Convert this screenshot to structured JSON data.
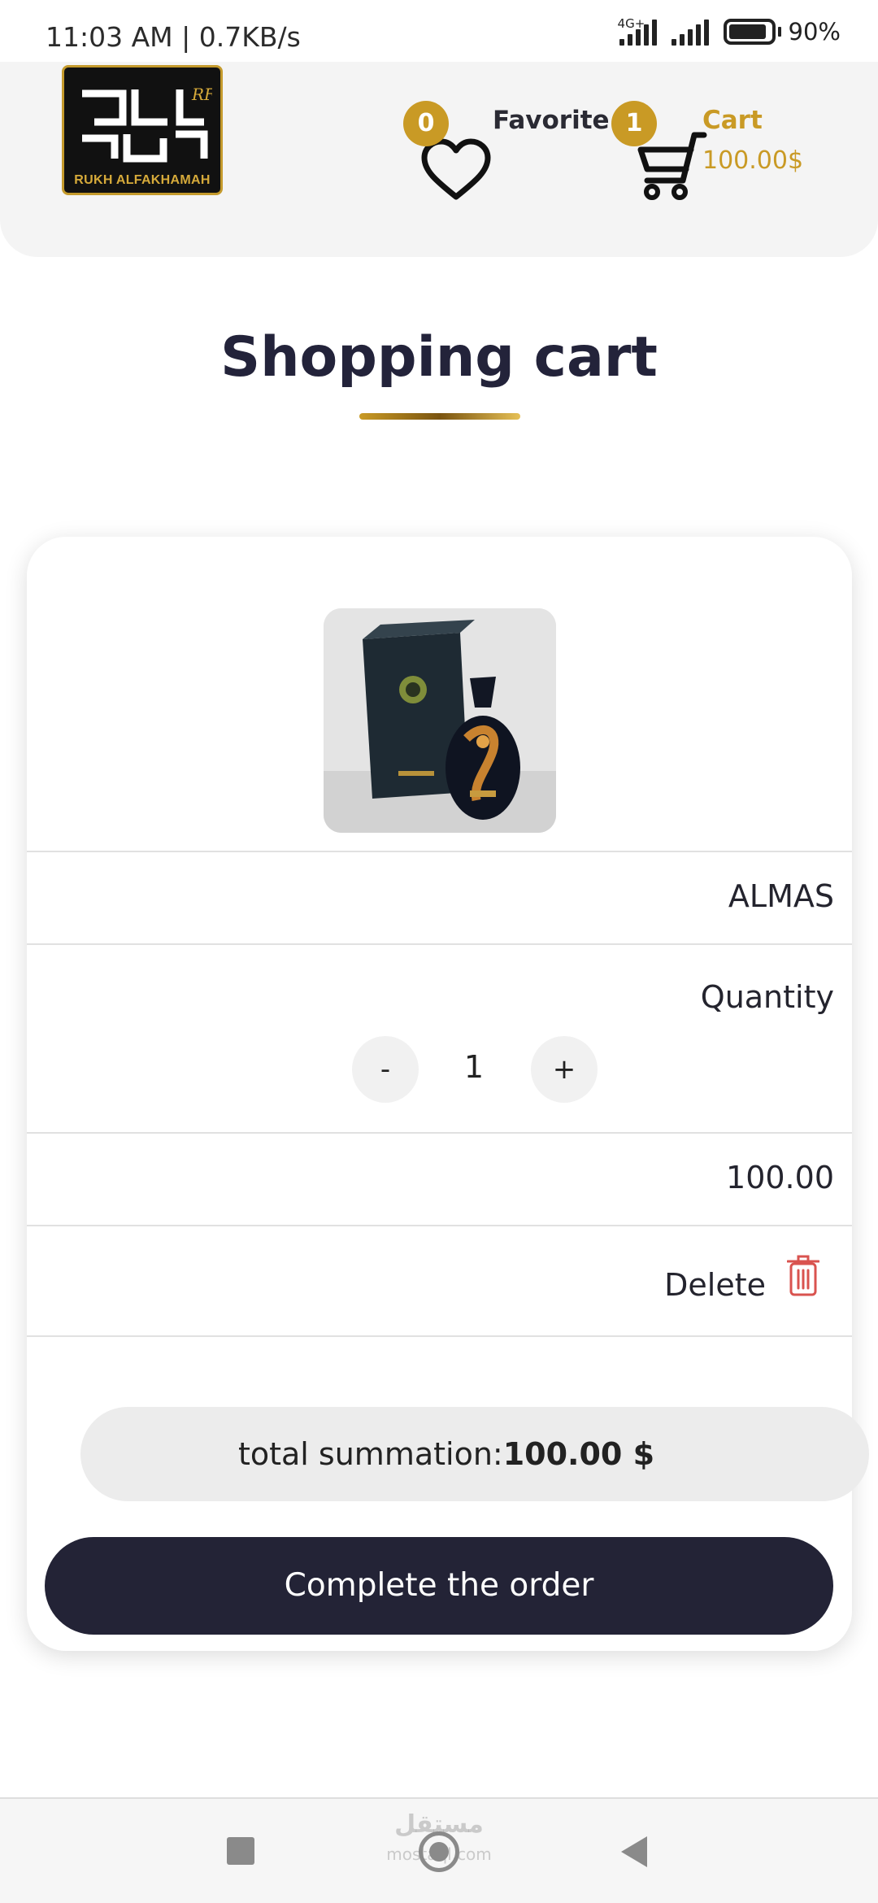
{
  "status_bar": {
    "time": "11:03 AM | 0.7KB/s",
    "network": "4G+",
    "battery": "90%"
  },
  "header": {
    "logo_text": "RUKH ALFAKHAMAH",
    "favorite_label": "Favorite",
    "favorite_count": "0",
    "cart_label": "Cart",
    "cart_count": "1",
    "cart_total": "100.00$"
  },
  "page": {
    "title": "Shopping cart"
  },
  "cart": {
    "product_name": "ALMAS",
    "quantity_label": "Quantity",
    "quantity_minus": "-",
    "quantity_value": "1",
    "quantity_plus": "+",
    "price": "100.00",
    "delete_label": "Delete",
    "total_label": "total summation:",
    "total_value": "100.00 $",
    "complete_button": "Complete the order"
  },
  "nav_bar": {
    "watermark": "مستقل",
    "watermark_sub": "mostaql.com"
  },
  "colors": {
    "accent_gold": "#c99a25",
    "dark_navy": "#232336",
    "delete_red": "#d9534f"
  },
  "icons": [
    "heart-icon",
    "cart-icon",
    "trash-icon",
    "home-icon",
    "back-icon",
    "recents-icon"
  ]
}
